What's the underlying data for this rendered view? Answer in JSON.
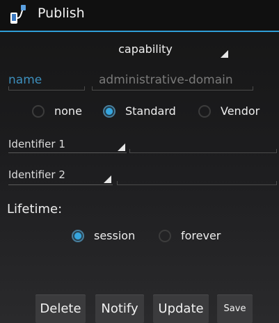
{
  "titlebar": {
    "title": "Publish",
    "icon": "app-icon",
    "accent": "#2f9ed6"
  },
  "form": {
    "capability_spinner": "capability",
    "name_field": "name",
    "domain_field": "administrative-domain",
    "type_radio": [
      {
        "label": "none",
        "checked": false
      },
      {
        "label": "Standard",
        "checked": true
      },
      {
        "label": "Vendor",
        "checked": false
      }
    ],
    "identifier1_label": "Identifier 1",
    "identifier1_value": "",
    "identifier2_label": "Identifier 2",
    "identifier2_value": "",
    "lifetime_label": "Lifetime:",
    "lifetime_radio": [
      {
        "label": "session",
        "checked": true
      },
      {
        "label": "forever",
        "checked": false
      }
    ]
  },
  "buttons": {
    "delete": "Delete",
    "notify": "Notify",
    "update": "Update",
    "save": "Save"
  }
}
